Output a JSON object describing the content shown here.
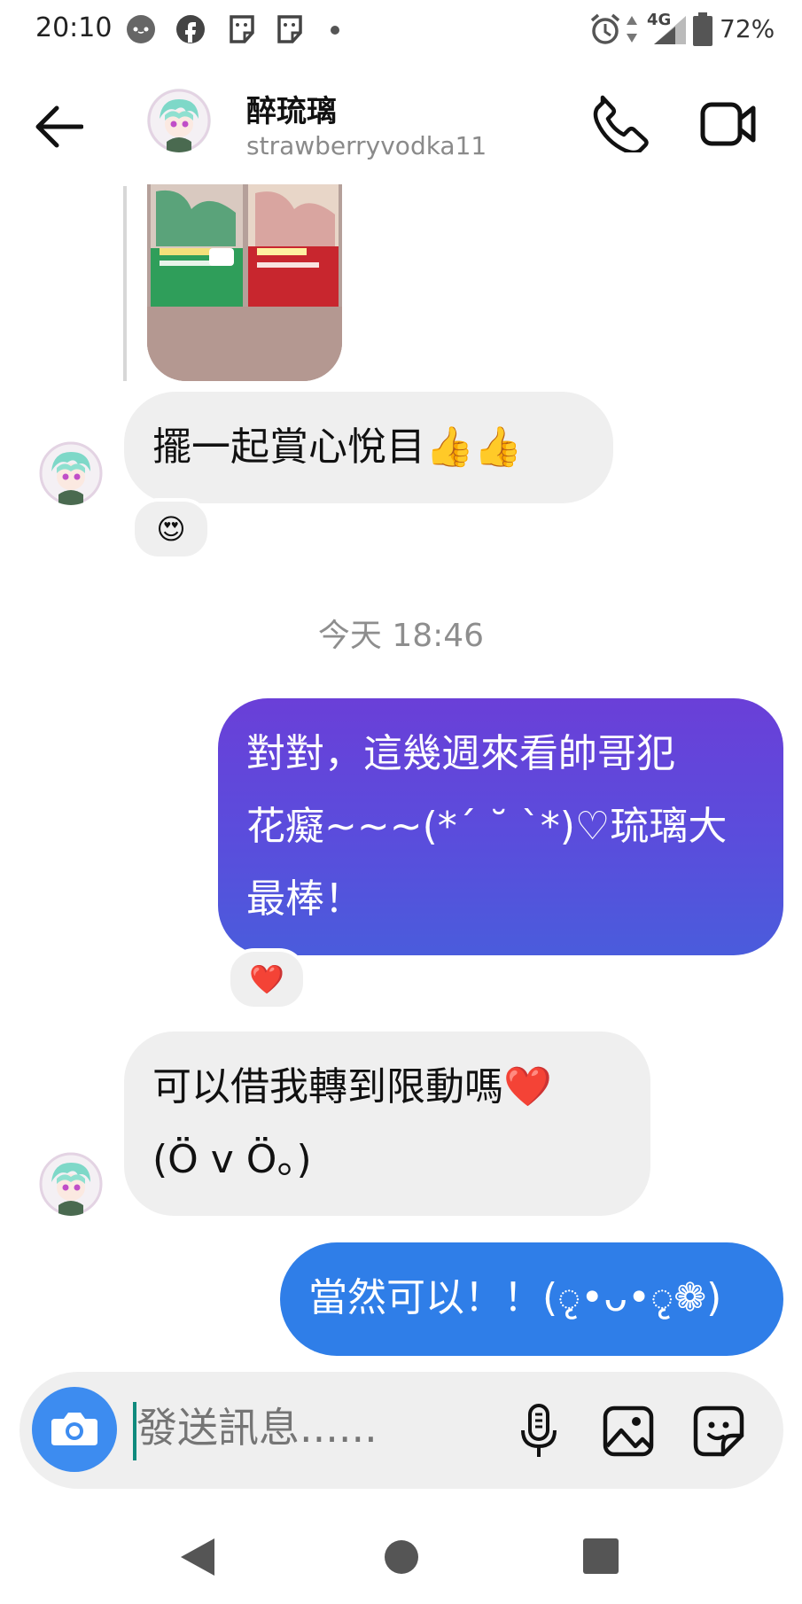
{
  "status_bar": {
    "time": "20:10",
    "network": "4G",
    "battery": "72%"
  },
  "header": {
    "name": "醉琉璃",
    "username": "strawberryvodka11",
    "icons": [
      "back-arrow-icon",
      "phone-icon",
      "video-call-icon"
    ]
  },
  "messages": [
    {
      "from": "them",
      "text": "擺一起賞心悅目👍👍",
      "reaction": "😍"
    },
    {
      "type": "date",
      "text": "今天 18:46"
    },
    {
      "from": "me",
      "lines": [
        "對對，這幾週來看帥哥犯",
        "花癡~~~(*´ ˘ `*)♡琉璃大",
        "最棒！"
      ],
      "reaction": "❤️"
    },
    {
      "from": "them",
      "lines": [
        "可以借我轉到限動嗎❤️",
        "(Ö v Ö。)"
      ]
    },
    {
      "from": "me",
      "text": "當然可以！！(ृ•ᴗ•ृ❁)"
    }
  ],
  "composer": {
    "placeholder": "發送訊息......",
    "icons": [
      "camera-icon",
      "microphone-icon",
      "gallery-icon",
      "sticker-icon"
    ]
  },
  "colors": {
    "incoming_bubble": "#efefef",
    "outgoing_gradient_top": "#6a3fd8",
    "outgoing_gradient_bottom": "#4a5cdc",
    "outgoing_blue": "#2f7ee8",
    "camera_button": "#3d8cf0"
  }
}
